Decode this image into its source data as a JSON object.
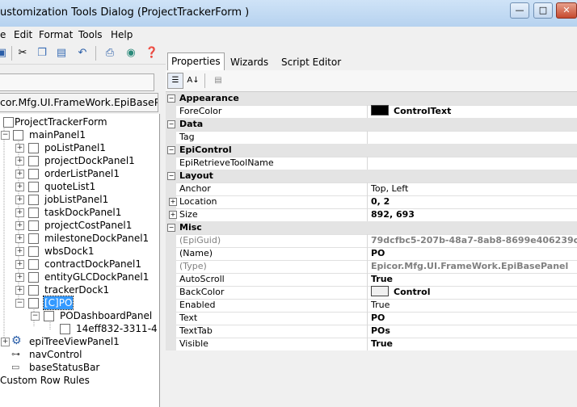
{
  "window": {
    "title": "ustomization Tools Dialog  (ProjectTrackerForm )",
    "min_label": "—",
    "max_label": "□",
    "close_label": "✕"
  },
  "menu": [
    "e",
    "Edit",
    "Format",
    "Tools",
    "Help"
  ],
  "toolbar": {
    "icons": [
      "save-icon",
      "cut-icon",
      "copy-icon",
      "paste-icon",
      "undo-icon",
      "print-icon",
      "print-preview-icon",
      "help-icon"
    ]
  },
  "left": {
    "class_path": "cor.Mfg.UI.FrameWork.EpiBasePa",
    "tree": [
      {
        "label": "ProjectTrackerForm"
      },
      {
        "label": "mainPanel1"
      },
      {
        "label": "poListPanel1"
      },
      {
        "label": "projectDockPanel1"
      },
      {
        "label": "orderListPanel1"
      },
      {
        "label": "quoteList1"
      },
      {
        "label": "jobListPanel1"
      },
      {
        "label": "taskDockPanel1"
      },
      {
        "label": "projectCostPanel1"
      },
      {
        "label": "milestoneDockPanel1"
      },
      {
        "label": "wbsDock1"
      },
      {
        "label": "contractDockPanel1"
      },
      {
        "label": "entityGLCDockPanel1"
      },
      {
        "label": "trackerDock1"
      },
      {
        "label": "[C]PO"
      },
      {
        "label": "PODashboardPanel"
      },
      {
        "label": "14eff832-3311-4"
      },
      {
        "label": "epiTreeViewPanel1"
      },
      {
        "label": "navControl"
      },
      {
        "label": "baseStatusBar"
      },
      {
        "label": "Custom Row Rules"
      }
    ]
  },
  "tabs": [
    "Properties",
    "Wizards",
    "Script Editor"
  ],
  "properties": [
    {
      "name": "Appearance"
    },
    {
      "name": "ForeColor",
      "value": "ControlText"
    },
    {
      "name": "Data"
    },
    {
      "name": "Tag",
      "value": ""
    },
    {
      "name": "EpiControl"
    },
    {
      "name": "EpiRetrieveToolName",
      "value": ""
    },
    {
      "name": "Layout"
    },
    {
      "name": "Anchor",
      "value": "Top, Left"
    },
    {
      "name": "Location",
      "value": "0, 2"
    },
    {
      "name": "Size",
      "value": "892, 693"
    },
    {
      "name": "Misc"
    },
    {
      "name": "(EpiGuid)",
      "value": "79dcfbc5-207b-48a7-8ab8-8699e406239c"
    },
    {
      "name": "(Name)",
      "value": "PO"
    },
    {
      "name": "(Type)",
      "value": "Epicor.Mfg.UI.FrameWork.EpiBasePanel"
    },
    {
      "name": "AutoScroll",
      "value": "True"
    },
    {
      "name": "BackColor",
      "value": "Control"
    },
    {
      "name": "Enabled",
      "value": "True"
    },
    {
      "name": "Text",
      "value": "PO"
    },
    {
      "name": "TextTab",
      "value": "POs"
    },
    {
      "name": "Visible",
      "value": "True"
    }
  ],
  "colors": {
    "selection": "#3399ff",
    "forecolor_swatch": "#000000",
    "backcolor_swatch": "#f0f0f0"
  }
}
